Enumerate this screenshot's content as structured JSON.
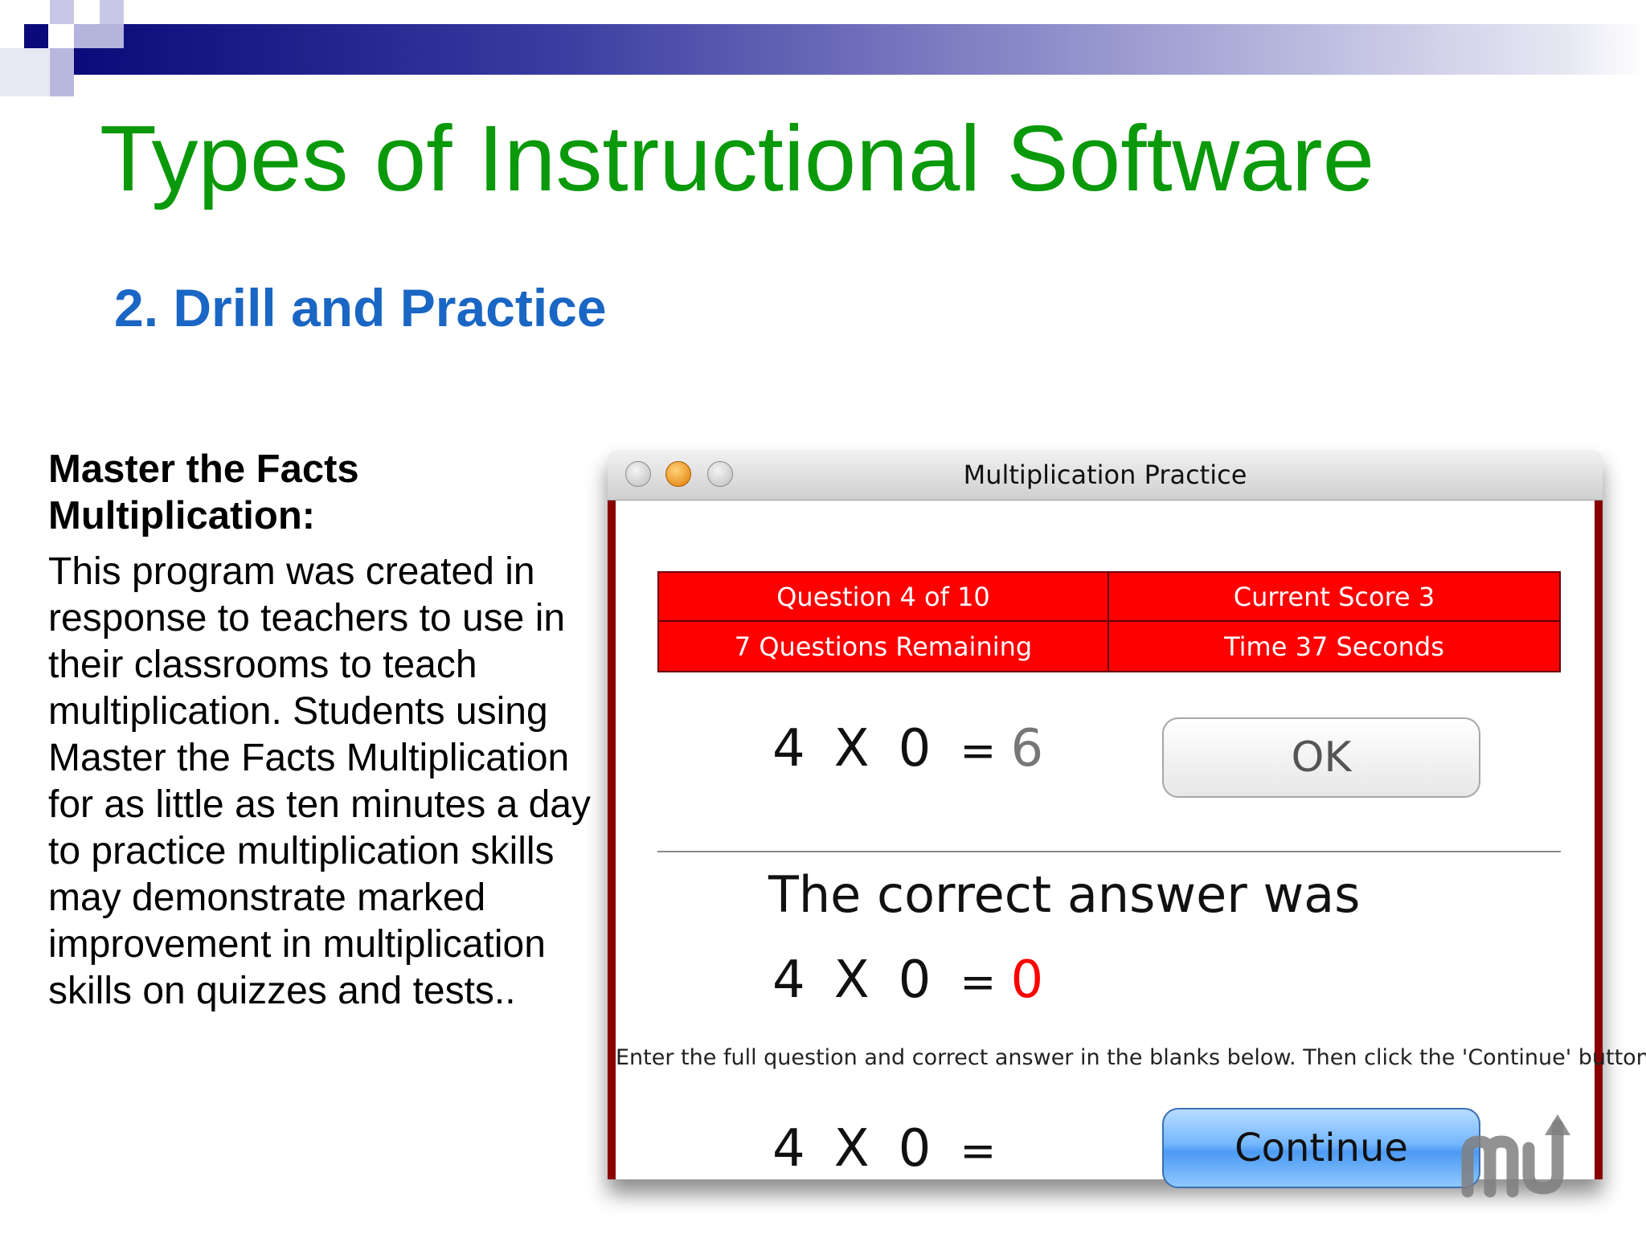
{
  "slide": {
    "title": "Types of Instructional Software",
    "subtitle": "2. Drill and Practice"
  },
  "description": {
    "heading": "Master the Facts Multiplication:",
    "body": "This program was created in response to teachers to use in their classrooms to teach multiplication. Students using Master the Facts Multiplication for as little as ten minutes a day to practice multiplication skills may demonstrate marked improvement in multiplication skills on quizzes and tests.."
  },
  "window": {
    "title": "Multiplication Practice",
    "status": {
      "question": "Question 4 of 10",
      "score": "Current Score 3",
      "remaining": "7 Questions Remaining",
      "time": "Time 37 Seconds"
    },
    "problem": {
      "a": "4",
      "op": "X",
      "b": "0",
      "eq": "=",
      "user_answer": "6"
    },
    "ok_label": "OK",
    "correct_label": "The correct answer was",
    "correct": {
      "a": "4",
      "op": "X",
      "b": "0",
      "eq": "=",
      "answer": "0"
    },
    "instruction": "Enter the full question and correct answer in the blanks below.  Then click the 'Continue' button.",
    "entry": {
      "a": "4",
      "op": "X",
      "b": "0",
      "eq": "="
    },
    "continue_label": "Continue"
  },
  "colors": {
    "title": "#0a990a",
    "subtitle": "#1a66c4",
    "status_bg": "#ff0000",
    "window_border": "#8a0000",
    "wrong_answer": "#777777",
    "correct_answer": "#ff0000",
    "continue_button": "#74b7ff"
  },
  "icons": [
    "close-icon",
    "minimize-icon",
    "zoom-icon",
    "macupdate-logo-icon"
  ]
}
